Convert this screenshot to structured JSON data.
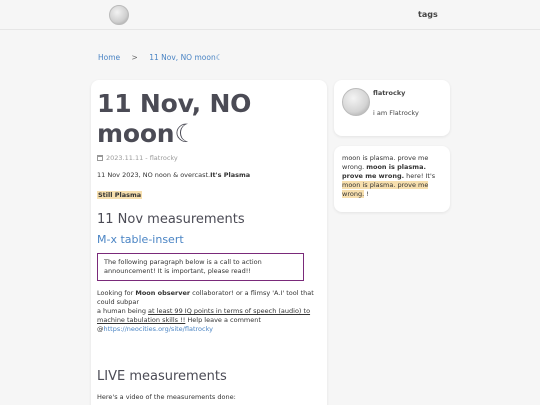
{
  "header": {
    "tags_label": "tags"
  },
  "breadcrumb": {
    "home": "Home",
    "separator": ">",
    "current": "11 Nov, NO moon☾"
  },
  "post": {
    "title": "11 Nov, NO moon☾",
    "date": "2023.11.11 - flatrocky",
    "lead_prefix": "11 Nov 2023, NO noon & overcast.",
    "lead_bold": "It's Plasma",
    "highlight": "Still Plasma",
    "h2_measurements": "11 Nov measurements",
    "h3_link": "M-x table-insert",
    "callout": "The following paragraph below is a call to action announcement! It is important, please read!!",
    "para_1": "Looking for ",
    "para_bold": "Moon observer",
    "para_2": " collaborator! or a flimsy 'A.I' tool that could subpar",
    "para_3": "a human being ",
    "para_underline": "at least 99 IQ points in terms of speech (audio) to machine tabulation skills !!",
    "para_4": " Help leave a comment @",
    "para_link": "https://neocities.org/site/flatrocky",
    "h2_live": "LIVE measurements",
    "video_line": "Here's a video of the measurements done:"
  },
  "profile": {
    "name": "flatrocky",
    "bio": "i am Flatrocky"
  },
  "note": {
    "t1": "moon is plasma. prove me wrong. ",
    "t2": "moon is plasma. prove me wrong.",
    "t3": " here! It's ",
    "t4": "moon is plasma. prove me wrong.",
    "t5": " !"
  },
  "colors": {
    "accent": "#4a84c4",
    "highlight": "#f7dfae",
    "callout_border": "#7a2a7a"
  }
}
